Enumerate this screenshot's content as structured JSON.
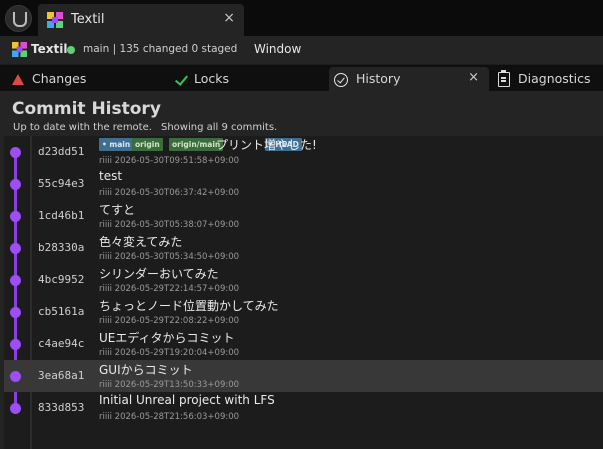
{
  "window": {
    "tab_title": "Textil",
    "tab_close": "×",
    "logo_icon": "unreal-engine-logo-icon",
    "app_icon": "textil-app-icon"
  },
  "menubar": {
    "app_name": "Textil",
    "branch_info": "main  |  135 changed  0 staged",
    "status_color": "#5fd07a",
    "menu_window": "Window"
  },
  "tabs": [
    {
      "label": "Changes",
      "icon": "warning-triangle-icon",
      "active": false
    },
    {
      "label": "Locks",
      "icon": "checkmark-icon",
      "active": false
    },
    {
      "label": "History",
      "icon": "circle-check-icon",
      "active": true,
      "close": "×"
    },
    {
      "label": "Diagnostics",
      "icon": "clipboard-icon",
      "active": false
    }
  ],
  "history": {
    "title": "Commit History",
    "sync_status": "Up to date with the remote.",
    "commit_count_text": "Showing all 9 commits.",
    "graph_color": "#9b4ff5"
  },
  "commits": [
    {
      "hash": "d23dd51",
      "message": "プリント増やした!",
      "author": "riiii",
      "date": "2026-05-30T09:51:58+09:00",
      "refs": [
        {
          "label": "• main",
          "kind": "head"
        },
        {
          "label": "origin",
          "kind": "remote"
        },
        {
          "label": "origin/main",
          "kind": "remote"
        },
        {
          "label": "• HEAD",
          "kind": "head"
        }
      ]
    },
    {
      "hash": "55c94e3",
      "message": "test",
      "author": "riiii",
      "date": "2026-05-30T06:37:42+09:00"
    },
    {
      "hash": "1cd46b1",
      "message": "てすと",
      "author": "riiii",
      "date": "2026-05-30T05:38:07+09:00"
    },
    {
      "hash": "b28330a",
      "message": "色々変えてみた",
      "author": "riiii",
      "date": "2026-05-30T05:34:50+09:00"
    },
    {
      "hash": "4bc9952",
      "message": "シリンダーおいてみた",
      "author": "riiii",
      "date": "2026-05-29T22:14:57+09:00"
    },
    {
      "hash": "cb5161a",
      "message": "ちょっとノード位置動かしてみた",
      "author": "riiii",
      "date": "2026-05-29T22:08:22+09:00"
    },
    {
      "hash": "c4ae94c",
      "message": "UEエディタからコミット",
      "author": "riiii",
      "date": "2026-05-29T19:20:04+09:00"
    },
    {
      "hash": "3ea68a1",
      "message": "GUIからコミット",
      "author": "riiii",
      "date": "2026-05-29T13:50:33+09:00",
      "selected": true
    },
    {
      "hash": "833d853",
      "message": "Initial Unreal project with LFS",
      "author": "riiii",
      "date": "2026-05-28T21:56:03+09:00"
    }
  ]
}
